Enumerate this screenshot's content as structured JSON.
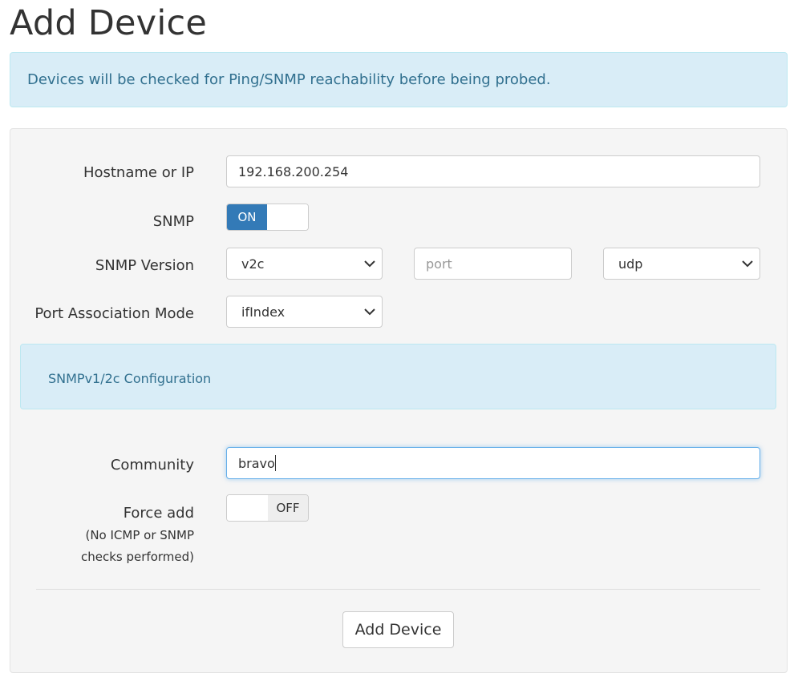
{
  "page": {
    "title": "Add Device"
  },
  "alert": {
    "text": "Devices will be checked for Ping/SNMP reachability before being probed."
  },
  "form": {
    "hostname": {
      "label": "Hostname or IP",
      "value": "192.168.200.254"
    },
    "snmp": {
      "label": "SNMP",
      "state": "ON"
    },
    "snmp_version": {
      "label": "SNMP Version",
      "version_value": "v2c",
      "port_placeholder": "port",
      "transport_value": "udp"
    },
    "port_association": {
      "label": "Port Association Mode",
      "value": "ifIndex"
    },
    "snmp_config_heading": "SNMPv1/2c Configuration",
    "community": {
      "label": "Community",
      "value": "bravo"
    },
    "force_add": {
      "label": "Force add",
      "hint_line1": "(No ICMP or SNMP",
      "hint_line2": "checks performed)",
      "state": "OFF"
    },
    "submit_label": "Add Device"
  },
  "colors": {
    "primary": "#337ab7",
    "info_bg": "#d9edf7",
    "info_text": "#31708f",
    "well_bg": "#f5f5f5"
  }
}
